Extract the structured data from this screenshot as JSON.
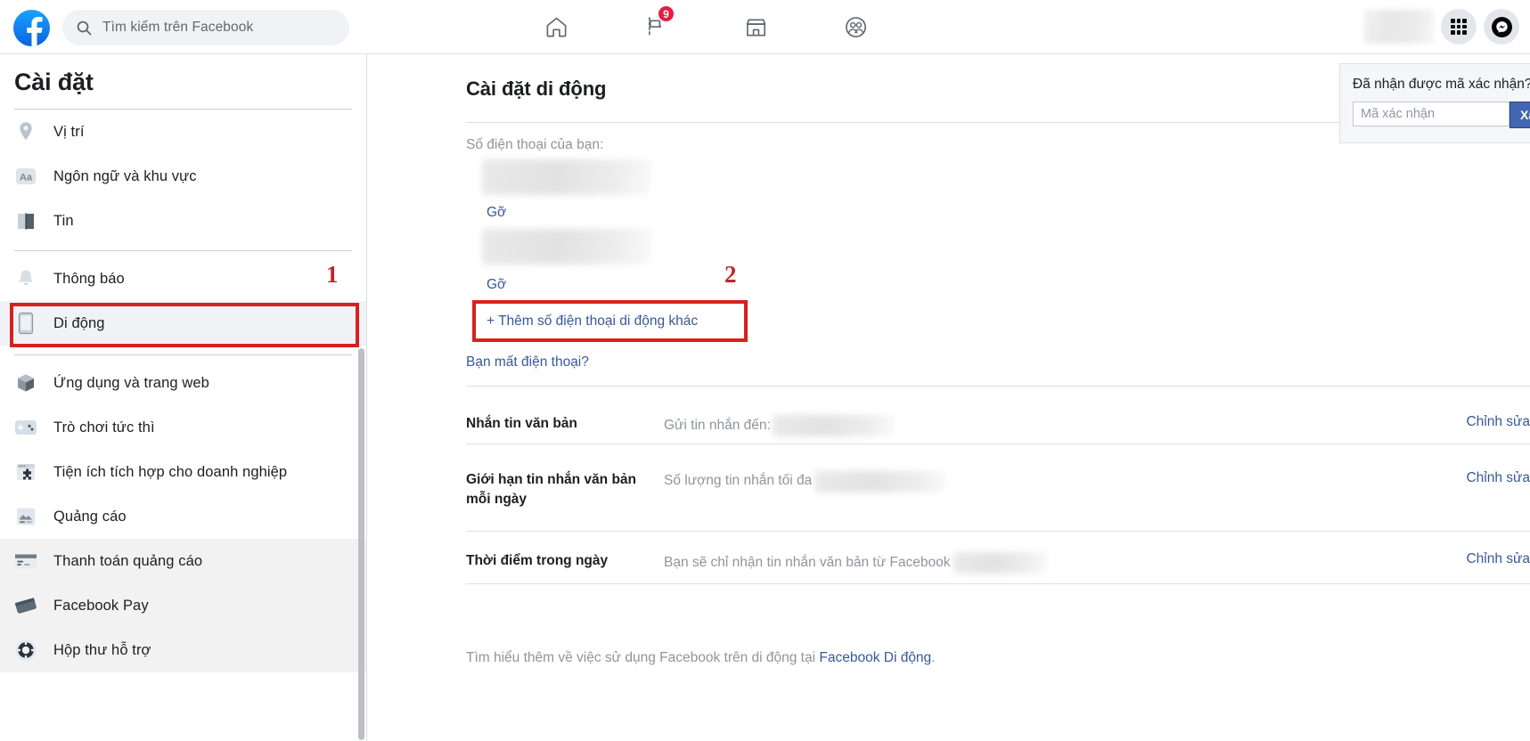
{
  "header": {
    "logo_icon": "facebook-logo-icon",
    "search": {
      "icon": "search-icon",
      "placeholder": "Tìm kiếm trên Facebook"
    },
    "nav": [
      {
        "name": "home",
        "icon": "home-icon",
        "badge": ""
      },
      {
        "name": "pages-flag",
        "icon": "flag-icon",
        "badge": "9"
      },
      {
        "name": "marketplace",
        "icon": "shop-icon",
        "badge": ""
      },
      {
        "name": "groups",
        "icon": "groups-icon",
        "badge": ""
      }
    ],
    "right": {
      "profile_icon": "profile-avatar",
      "menu_icon": "grid-menu-icon",
      "messenger_icon": "messenger-icon"
    }
  },
  "sidebar": {
    "title": "Cài đặt",
    "groups": [
      {
        "items": [
          {
            "label": "Vị trí",
            "icon": "location-pin-icon",
            "state": "normal"
          },
          {
            "label": "Ngôn ngữ và khu vực",
            "icon": "language-aa-icon",
            "state": "normal"
          },
          {
            "label": "Tin",
            "icon": "stories-book-icon",
            "state": "normal"
          }
        ]
      },
      {
        "items": [
          {
            "label": "Thông báo",
            "icon": "bell-icon",
            "state": "normal"
          },
          {
            "label": "Di động",
            "icon": "mobile-phone-icon",
            "state": "active"
          }
        ]
      },
      {
        "items": [
          {
            "label": "Ứng dụng và trang web",
            "icon": "cube-icon",
            "state": "normal"
          },
          {
            "label": "Trò chơi tức thì",
            "icon": "instant-games-icon",
            "state": "normal"
          },
          {
            "label": "Tiện ích tích hợp cho doanh nghiệp",
            "icon": "business-integration-icon",
            "state": "normal"
          },
          {
            "label": "Quảng cáo",
            "icon": "ads-image-icon",
            "state": "normal"
          },
          {
            "label": "Thanh toán quảng cáo",
            "icon": "credit-card-icon",
            "state": "hovered"
          },
          {
            "label": "Facebook Pay",
            "icon": "fb-pay-card-icon",
            "state": "hovered"
          },
          {
            "label": "Hộp thư hỗ trợ",
            "icon": "support-lifebuoy-icon",
            "state": "hovered"
          }
        ]
      }
    ]
  },
  "main": {
    "title": "Cài đặt di động",
    "phones": {
      "label": "Số điện thoại của bạn:",
      "entries": [
        {
          "number_redacted": "",
          "remove_label": "Gỡ"
        },
        {
          "number_redacted": "",
          "remove_label": "Gỡ"
        }
      ],
      "add_link": "+ Thêm số điện thoại di động khác",
      "lost_phone_link": "Bạn mất điện thoại?"
    },
    "confirm": {
      "title": "Đã nhận được mã xác nhận?",
      "input_placeholder": "Mã xác nhận",
      "input_value": "",
      "button_label": "Xác nhận"
    },
    "rows": [
      {
        "label": "Nhắn tin văn bản",
        "value_prefix": "Gửi tin nhắn đến:",
        "value_redacted": "",
        "edit_label": "Chỉnh sửa"
      },
      {
        "label": "Giới hạn tin nhắn văn bản mỗi ngày",
        "value_prefix": "Số lượng tin nhắn tối đa",
        "value_redacted": "",
        "edit_label": "Chỉnh sửa"
      },
      {
        "label": "Thời điểm trong ngày",
        "value_prefix": "Bạn sẽ chỉ nhận tin nhắn văn bản từ Facebook",
        "value_redacted": "",
        "edit_label": "Chỉnh sửa"
      }
    ],
    "footer": {
      "text_before": "Tìm hiểu thêm về việc sử dụng Facebook trên di động tại ",
      "link_label": "Facebook Di động",
      "text_after": "."
    }
  },
  "annotations": [
    {
      "number": "1",
      "target": "sidebar-item-di-dong"
    },
    {
      "number": "2",
      "target": "add-phone-link"
    }
  ],
  "colors": {
    "fb_blue": "#1877f2",
    "link_blue": "#385898",
    "button_blue": "#4267b2",
    "badge_red": "#e41e3f",
    "annotation_red": "#d82020",
    "muted_text": "#90949c"
  }
}
